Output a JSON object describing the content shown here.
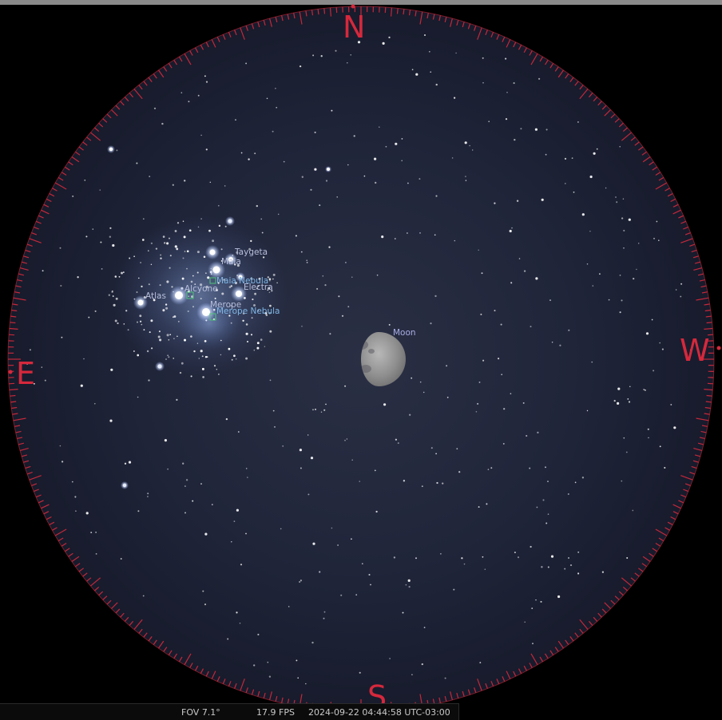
{
  "compass": {
    "north": "N",
    "south": "S",
    "east": "E",
    "west": "W"
  },
  "labels": {
    "stars": [
      "Taygeta",
      "Maia",
      "Electra",
      "Alcyone",
      "Atlas",
      "Merope"
    ],
    "nebulae": [
      "Maia Nebula",
      "Merope Nebula"
    ],
    "moon": "Moon"
  },
  "status": {
    "fov": "FOV 7.1°",
    "fps": "17.9 FPS",
    "datetime": "2024-09-22 04:44:58 UTC-03:00"
  },
  "colors": {
    "sky": "#1f2438",
    "compass": "#d6283c",
    "star_label": "#b8bfdc",
    "nebula_label": "#7fb6e6",
    "moon_label": "#a9aee6"
  }
}
